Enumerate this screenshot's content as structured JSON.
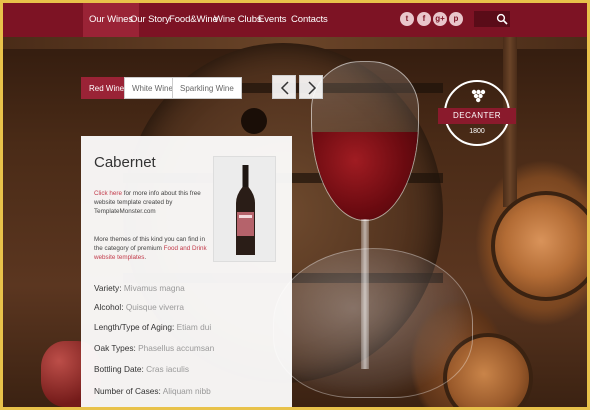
{
  "nav": {
    "items": [
      "Our Wines",
      "Our Story",
      "Food&Wine",
      "Wine Clubs",
      "Events",
      "Contacts"
    ],
    "active": "Our Wines"
  },
  "social": [
    "twitter-icon",
    "facebook-icon",
    "google-plus-icon",
    "pinterest-icon"
  ],
  "social_glyphs": [
    "t",
    "f",
    "g+",
    "p"
  ],
  "categories": [
    "Red Wine",
    "White Wine",
    "Sparkling Wine"
  ],
  "badge": {
    "title": "DECANTER",
    "year": "1800"
  },
  "panel": {
    "title": "Cabernet",
    "info1_link": "Click here",
    "info1_text": " for more info about this free website template created by TemplateMonster.com",
    "info2_text": "More themes of this kind you can find in the category of premium ",
    "info2_link": "Food and Drink website templates",
    "info2_end": ".",
    "specs": [
      {
        "label": "Variety:",
        "value": "Mivamus magna"
      },
      {
        "label": "Alcohol:",
        "value": "Quisque viverra"
      },
      {
        "label": "Length/Type of Aging:",
        "value": "Etiam dui"
      },
      {
        "label": "Oak Types:",
        "value": "Phasellus accumsan"
      },
      {
        "label": "Bottling Date:",
        "value": "Cras iaculis"
      },
      {
        "label": "Number of Cases:",
        "value": "Aliquam nibb"
      }
    ]
  },
  "colors": {
    "brand": "#7d1324",
    "accent": "#9a2336",
    "link": "#c23a4a"
  }
}
